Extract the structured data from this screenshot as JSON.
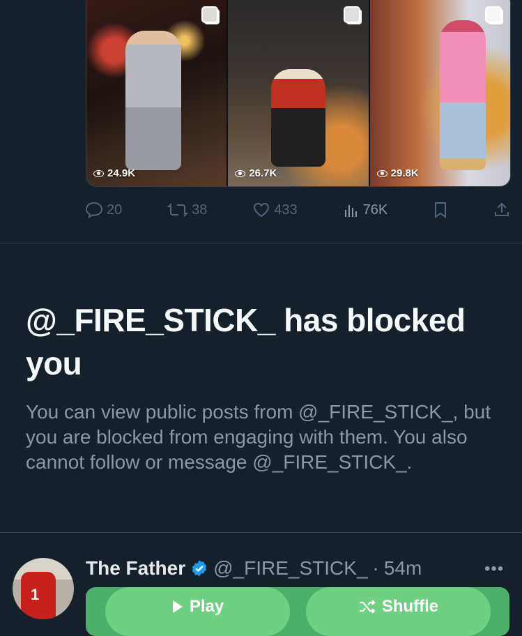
{
  "media": {
    "tiles": [
      {
        "views": "24.9K"
      },
      {
        "views": "26.7K"
      },
      {
        "views": "29.8K"
      }
    ]
  },
  "actions": {
    "replies": "20",
    "reposts": "38",
    "likes": "433",
    "views": "76K"
  },
  "blocked": {
    "title": "@_FIRE_STICK_ has blocked you",
    "body": "You can view public posts from @_FIRE_STICK_, but you are blocked from engaging with them. You also cannot follow or message @_FIRE_STICK_."
  },
  "next_tweet": {
    "avatar_jersey_number": "1",
    "display_name": "The Father",
    "handle": "@_FIRE_STICK_",
    "separator": "·",
    "time": "54m",
    "more": "•••",
    "player": {
      "play_label": "Play",
      "shuffle_label": "Shuffle"
    }
  },
  "colors": {
    "background": "#15202b",
    "divider": "#38444d",
    "muted_text": "#8b98a5",
    "verified": "#1d9bf0",
    "player_green": "#4caf6a"
  }
}
